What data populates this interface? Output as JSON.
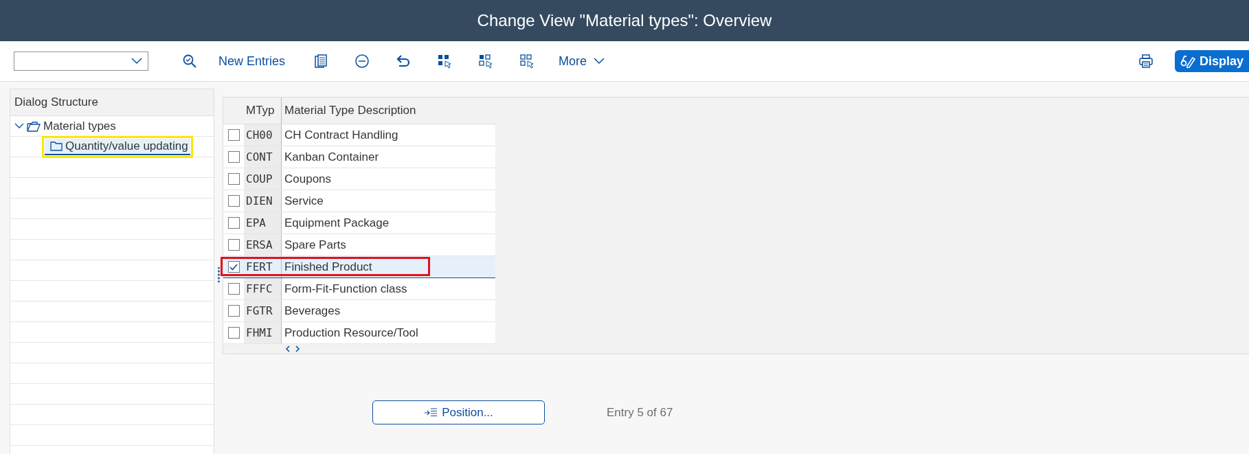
{
  "window": {
    "title": "Change View \"Material types\": Overview"
  },
  "toolbar": {
    "new_entries": "New Entries",
    "more": "More",
    "display": "Display"
  },
  "sidebar": {
    "title": "Dialog Structure",
    "items": [
      {
        "label": "Material types",
        "expanded": true,
        "selected": false,
        "highlighted": false,
        "children": [
          {
            "label": "Quantity/value updating",
            "selected": true,
            "highlighted": true
          }
        ]
      }
    ]
  },
  "table": {
    "columns": [
      "MTyp",
      "Material Type Description"
    ],
    "rows": [
      {
        "code": "CH00",
        "description": "CH Contract Handling",
        "checked": false,
        "selected": false,
        "highlighted": false
      },
      {
        "code": "CONT",
        "description": "Kanban Container",
        "checked": false,
        "selected": false,
        "highlighted": false
      },
      {
        "code": "COUP",
        "description": "Coupons",
        "checked": false,
        "selected": false,
        "highlighted": false
      },
      {
        "code": "DIEN",
        "description": "Service",
        "checked": false,
        "selected": false,
        "highlighted": false
      },
      {
        "code": "EPA",
        "description": "Equipment Package",
        "checked": false,
        "selected": false,
        "highlighted": false
      },
      {
        "code": "ERSA",
        "description": "Spare Parts",
        "checked": false,
        "selected": false,
        "highlighted": false
      },
      {
        "code": "FERT",
        "description": "Finished Product",
        "checked": true,
        "selected": true,
        "highlighted": true
      },
      {
        "code": "FFFC",
        "description": "Form-Fit-Function class",
        "checked": false,
        "selected": false,
        "highlighted": false
      },
      {
        "code": "FGTR",
        "description": "Beverages",
        "checked": false,
        "selected": false,
        "highlighted": false
      },
      {
        "code": "FHMI",
        "description": "Production Resource/Tool",
        "checked": false,
        "selected": false,
        "highlighted": false
      }
    ]
  },
  "footer": {
    "position_button": "Position...",
    "entry_info": "Entry 5 of 67"
  }
}
